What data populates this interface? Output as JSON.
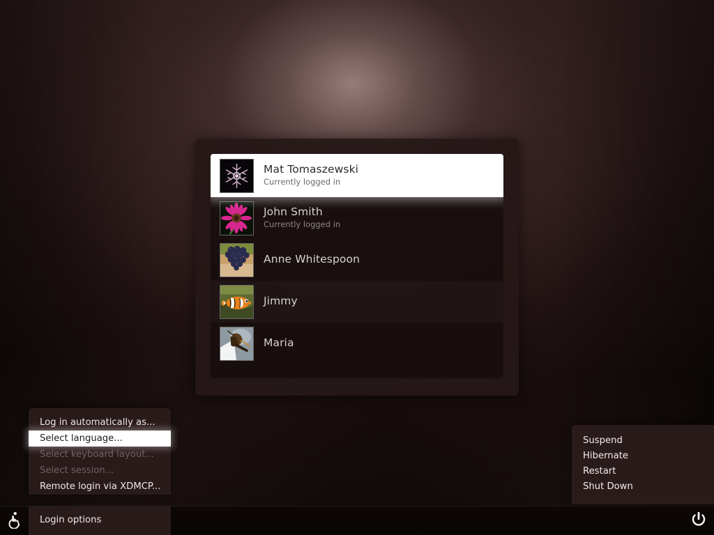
{
  "screen": {
    "background_color": "#1a0f0f",
    "accent_highlight": "#ffffff"
  },
  "greeter": {
    "users": [
      {
        "name": "Mat Tomaszewski",
        "status": "Currently logged in",
        "avatar": "snowflake-avatar",
        "selected": true
      },
      {
        "name": "John Smith",
        "status": "Currently logged in",
        "avatar": "pink-flower-avatar",
        "selected": false
      },
      {
        "name": "Anne Whitespoon",
        "status": "",
        "avatar": "grapes-avatar",
        "selected": false
      },
      {
        "name": "Jimmy",
        "status": "",
        "avatar": "clownfish-avatar",
        "selected": false
      },
      {
        "name": "Maria",
        "status": "",
        "avatar": "moth-avatar",
        "selected": false
      }
    ]
  },
  "taskbar": {
    "accessibility_icon": "wheelchair-icon",
    "power_icon": "power-icon",
    "login_options_label": "Login options"
  },
  "login_options_menu": {
    "items": [
      {
        "label": "Log in automatically as...",
        "state": "normal"
      },
      {
        "label": "Select language...",
        "state": "highlight"
      },
      {
        "label": "Select keyboard layout...",
        "state": "disabled"
      },
      {
        "label": "Select session...",
        "state": "disabled"
      },
      {
        "label": "Remote login via XDMCP...",
        "state": "normal"
      }
    ]
  },
  "power_menu": {
    "items": [
      {
        "label": "Suspend"
      },
      {
        "label": "Hibernate"
      },
      {
        "label": "Restart"
      },
      {
        "label": "Shut Down"
      }
    ]
  }
}
